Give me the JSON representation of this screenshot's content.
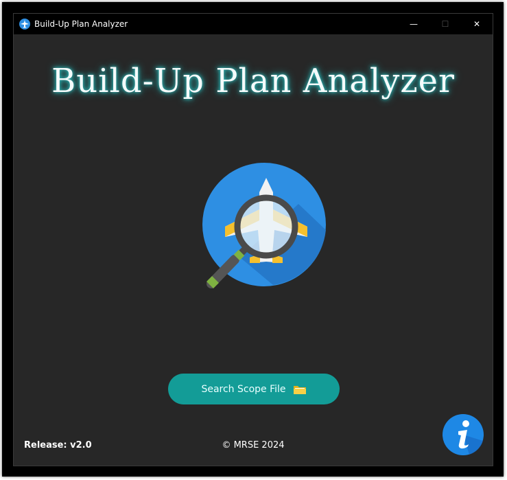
{
  "window": {
    "title": "Build-Up Plan Analyzer",
    "controls": {
      "minimize": "—",
      "maximize": "☐",
      "close": "✕"
    }
  },
  "main": {
    "heading": "Build-Up Plan Analyzer",
    "logo_icon": "airplane-magnifier-icon",
    "search_button_label": "Search Scope File",
    "search_button_icon": "folder-icon"
  },
  "footer": {
    "release": "Release: v2.0",
    "copyright": "© MRSE 2024",
    "info_icon": "info-icon"
  },
  "colors": {
    "background": "#272727",
    "titlebar": "#000000",
    "accent_teal": "#139c97",
    "heading_glow": "#2fd7d7",
    "logo_blue": "#2e8fe3",
    "info_blue": "#1e88e5"
  }
}
